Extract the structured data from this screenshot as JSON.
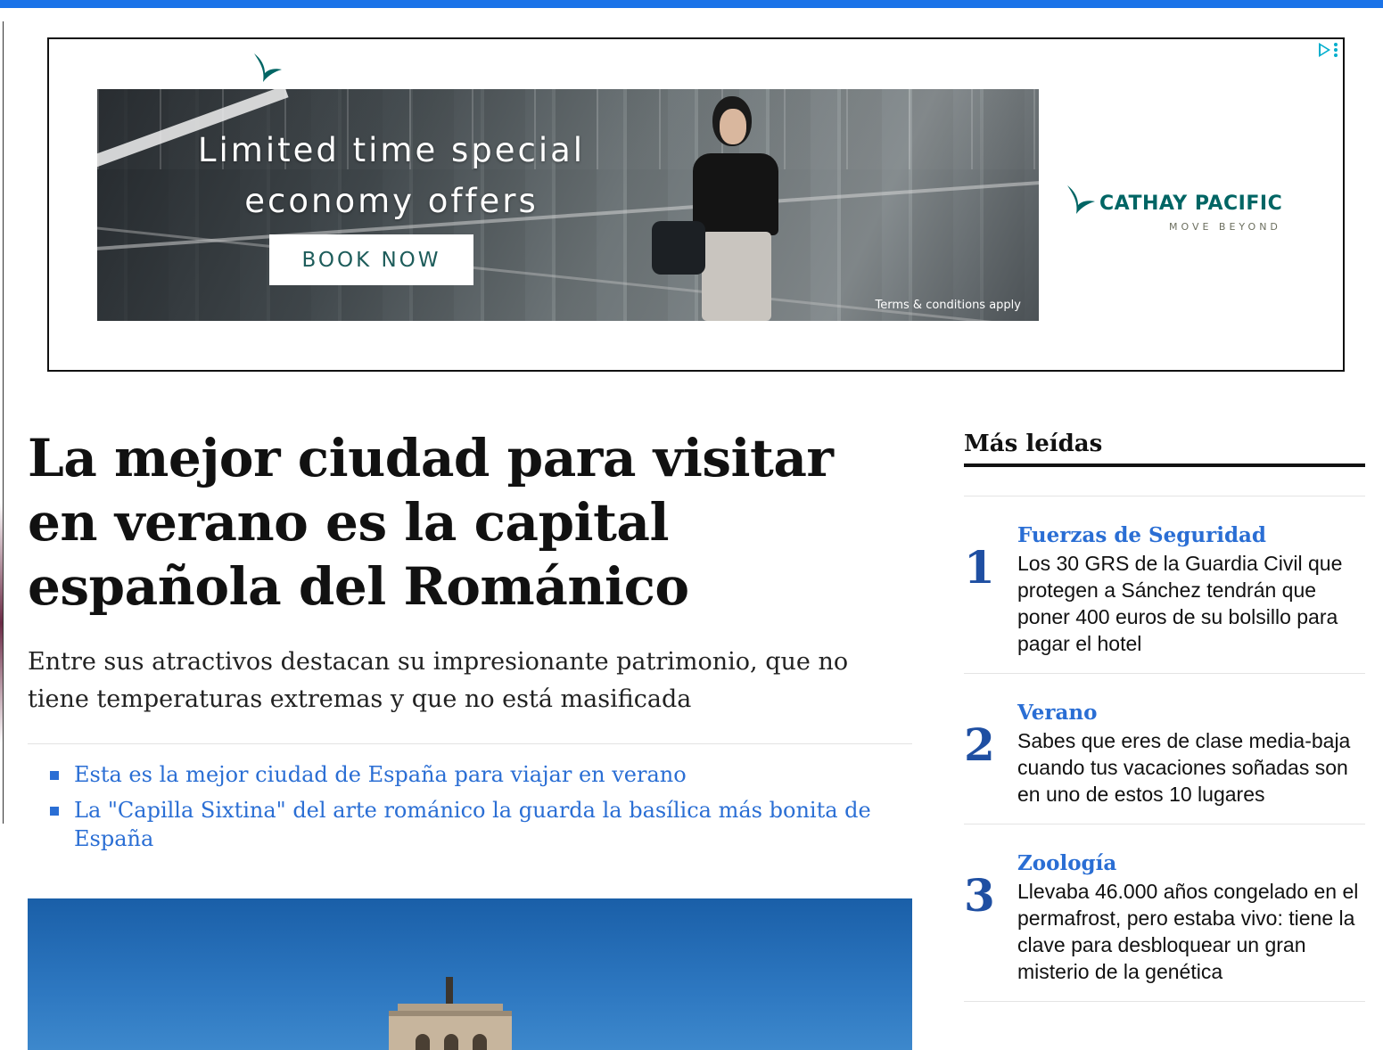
{
  "colors": {
    "top_bar": "#1a73e8",
    "link": "#2a6ed4",
    "rank_number": "#1f4fa2",
    "ad_brand": "#006564"
  },
  "ad": {
    "headline": "Limited time special economy offers",
    "cta": "BOOK NOW",
    "terms": "Terms & conditions apply",
    "brand_name": "CATHAY PACIFIC",
    "brand_tagline": "MOVE BEYOND",
    "choices_icon": "adchoices-icon"
  },
  "article": {
    "title": "La mejor ciudad para visitar en verano es la capital española del Románico",
    "subtitle": "Entre sus atractivos destacan su impresionante patrimonio, que no tiene temperaturas extremas y que no está masificada",
    "related": [
      "Esta es la mejor ciudad de España para viajar en verano",
      "La \"Capilla Sixtina\" del arte románico la guarda la basílica más bonita de España"
    ]
  },
  "sidebar": {
    "title": "Más leídas",
    "items": [
      {
        "rank": "1",
        "category": "Fuerzas de Seguridad",
        "text": "Los 30 GRS de la Guardia Civil que protegen a Sánchez tendrán que poner 400 euros de su bolsillo para pagar el hotel"
      },
      {
        "rank": "2",
        "category": "Verano",
        "text": "Sabes que eres de clase media-baja cuando tus vacaciones soñadas son en uno de estos 10 lugares"
      },
      {
        "rank": "3",
        "category": "Zoología",
        "text": "Llevaba 46.000 años congelado en el permafrost, pero estaba vivo: tiene la clave para desbloquear un gran misterio de la genética"
      }
    ]
  }
}
